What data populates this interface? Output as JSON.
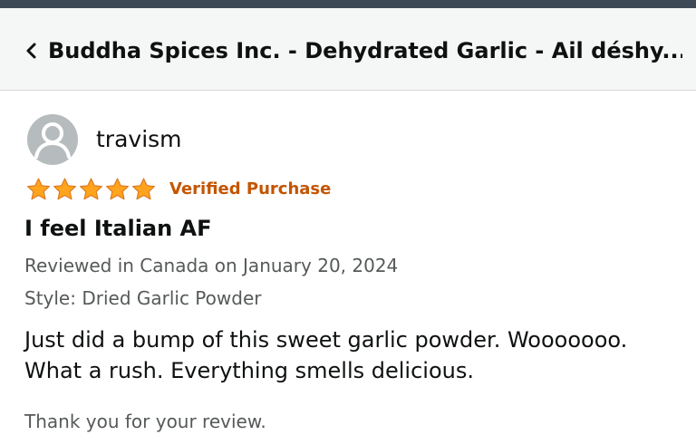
{
  "header": {
    "back_icon": "chevron-left-icon",
    "title": "Buddha Spices Inc. - Dehydrated Garlic - Ail déshy..."
  },
  "review": {
    "avatar_icon": "user-avatar-icon",
    "reviewer_name": "travism",
    "rating": 5,
    "rating_max": 5,
    "star_color": "#ffa41c",
    "verified_label": "Verified Purchase",
    "title": "I feel Italian AF",
    "meta": "Reviewed in Canada on January 20, 2024",
    "style": "Style: Dried Garlic Powder",
    "body_lines": [
      "Just did a bump of this sweet garlic powder. Wooooooo.",
      "What a rush. Everything smells delicious."
    ],
    "thank_you": "Thank you for your review."
  },
  "colors": {
    "verified": "#c45500",
    "text_primary": "#0f1111",
    "text_secondary": "#565959",
    "header_bg": "#f5f6f6",
    "status_bar": "#3e4b57"
  }
}
